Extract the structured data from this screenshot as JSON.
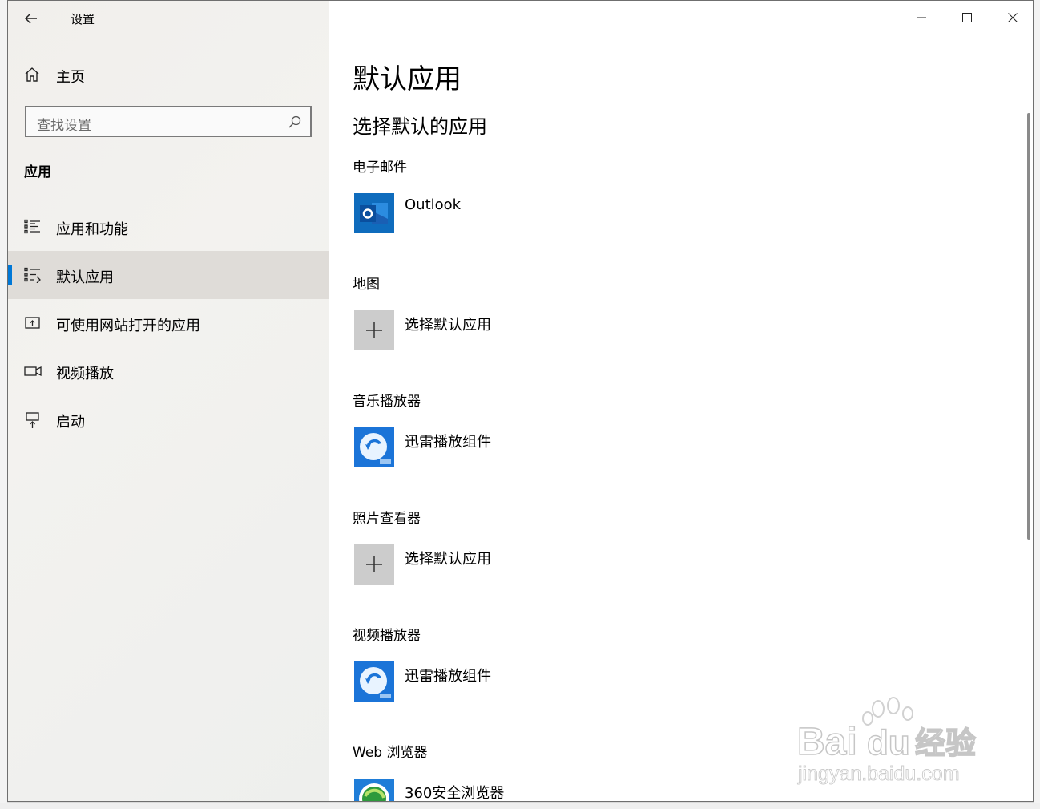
{
  "window": {
    "title": "设置",
    "controls": {
      "minimize": "minimize-icon",
      "maximize": "maximize-icon",
      "close": "close-icon"
    }
  },
  "sidebar": {
    "home_label": "主页",
    "search_placeholder": "查找设置",
    "section_label": "应用",
    "items": [
      {
        "label": "应用和功能",
        "icon": "apps-features-icon",
        "selected": false
      },
      {
        "label": "默认应用",
        "icon": "default-apps-icon",
        "selected": true
      },
      {
        "label": "可使用网站打开的应用",
        "icon": "apps-for-websites-icon",
        "selected": false
      },
      {
        "label": "视频播放",
        "icon": "video-playback-icon",
        "selected": false
      },
      {
        "label": "启动",
        "icon": "startup-icon",
        "selected": false
      }
    ]
  },
  "main": {
    "title": "默认应用",
    "subtitle": "选择默认的应用",
    "categories": [
      {
        "label": "电子邮件",
        "app": "Outlook",
        "icon": "outlook-icon"
      },
      {
        "label": "地图",
        "app": "选择默认应用",
        "icon": "plus-icon"
      },
      {
        "label": "音乐播放器",
        "app": "迅雷播放组件",
        "icon": "xunlei-player-icon"
      },
      {
        "label": "照片查看器",
        "app": "选择默认应用",
        "icon": "plus-icon"
      },
      {
        "label": "视频播放器",
        "app": "迅雷播放组件",
        "icon": "xunlei-player-icon"
      },
      {
        "label": "Web 浏览器",
        "app": "360安全浏览器",
        "icon": "360-browser-icon"
      }
    ]
  },
  "watermark": {
    "brand": "Bai",
    "brand2": "du",
    "suffix": "经验",
    "url": "jingyan.baidu.com"
  },
  "colors": {
    "accent": "#0078d7",
    "outlook": "#0a64c0",
    "xunlei": "#1b74d8",
    "browser": "#2e9a3c"
  }
}
